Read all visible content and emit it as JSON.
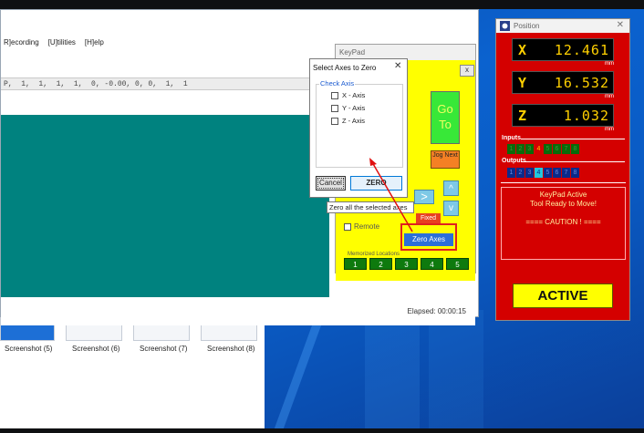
{
  "main_app": {
    "menu": [
      "R]ecording",
      "[U]tilities",
      "[H]elp"
    ],
    "strip_text": "P,  1,  1,  1,  1,  0, -0.00, 0, 0,  1,  1",
    "elapsed": "Elapsed: 00:00:15"
  },
  "thumbnails": [
    "Screenshot (5)",
    "Screenshot (6)",
    "Screenshot (7)",
    "Screenshot (8)"
  ],
  "keypad": {
    "title": "KeyPad",
    "close": "x",
    "goto_label": "Go To",
    "jog_next": "Jog Next",
    "arrow_right": ">",
    "arrow_up": "^",
    "arrow_down": "v",
    "fixed": "Fixed",
    "zero_axes": "Zero Axes",
    "remote_label": "Remote",
    "memorized_label": "Memorized Locations",
    "memorized_buttons": [
      "1",
      "2",
      "3",
      "4",
      "5"
    ],
    "tooltip": "Zero all the selected axes"
  },
  "dialog": {
    "title": "Select Axes to Zero",
    "close": "✕",
    "group_label": "Check Axis",
    "axes": [
      "X - Axis",
      "Y - Axis",
      "Z - Axis"
    ],
    "cancel": "Cancel",
    "zero": "ZERO"
  },
  "position_panel": {
    "title": "Position",
    "close": "✕",
    "axes": [
      {
        "label": "X",
        "value": "12.461",
        "unit": "mm"
      },
      {
        "label": "Y",
        "value": "16.532",
        "unit": "mm"
      },
      {
        "label": "Z",
        "value": "1.032",
        "unit": "mm"
      }
    ],
    "inputs_label": "Inputs",
    "inputs": [
      "1",
      "2",
      "3",
      "4",
      "5",
      "6",
      "7",
      "8"
    ],
    "inputs_active": 4,
    "outputs_label": "Outputs",
    "outputs": [
      "1",
      "2",
      "3",
      "4",
      "5",
      "6",
      "7",
      "8"
    ],
    "outputs_active": 4,
    "message_lines": [
      "KeyPad Active",
      "Tool Ready to Move!",
      "",
      "==== CAUTION ! ===="
    ],
    "status": "ACTIVE",
    "colors": {
      "panel": "#d40000",
      "readout_text": "#ffd000",
      "status_bg": "#ffff00"
    }
  }
}
